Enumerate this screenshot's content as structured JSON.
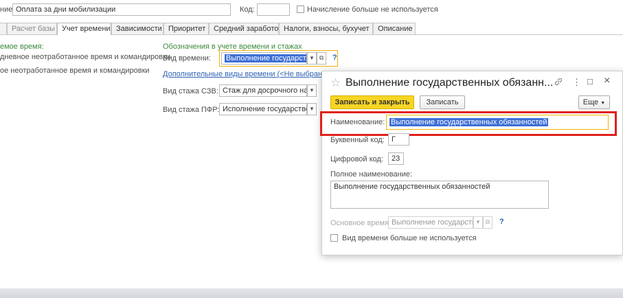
{
  "header": {
    "name_label_fragment": "ние:",
    "name_value": "Оплата за дни мобилизации",
    "code_label": "Код:",
    "code_value": "",
    "disabled_checkbox_label": "Начисление больше не используется"
  },
  "tabs": [
    {
      "label": "Расчет базы",
      "active": false,
      "dim": true
    },
    {
      "label": "Учет времени",
      "active": true,
      "dim": false
    },
    {
      "label": "Зависимости",
      "active": false,
      "dim": false
    },
    {
      "label": "Приоритет",
      "active": false,
      "dim": false
    },
    {
      "label": "Средний заработок",
      "active": false,
      "dim": false
    },
    {
      "label": "Налоги, взносы, бухучет",
      "active": false,
      "dim": false
    },
    {
      "label": "Описание",
      "active": false,
      "dim": false
    }
  ],
  "left_panel": {
    "heading": "емое время:",
    "line1": "дневное неотработанное время и командировки",
    "line2": "ое неотработанное время и командировки"
  },
  "time_section": {
    "heading": "Обозначения в учете времени и стажах",
    "time_kind_label": "Вид времени:",
    "time_kind_value": "Выполнение государстве",
    "help_mark": "?",
    "additional_link": "Дополнительные виды времени (<Не выбраны>)",
    "szv_label": "Вид стажа СЗВ:",
    "szv_value": "Стаж для досрочного наз",
    "pfr_label": "Вид стажа ПФР:",
    "pfr_value": "Исполнение государстве"
  },
  "dialog": {
    "star": "☆",
    "title": "Выполнение государственных обязанн...",
    "link_icon": "🔗",
    "more_icon": "⋮",
    "maximize_icon": "□",
    "close_icon": "×",
    "save_close_label": "Записать и закрыть",
    "save_label": "Записать",
    "more_label": "Еще",
    "name_label": "Наименование:",
    "name_value": "Выполнение государственных обязанностей",
    "letter_code_label": "Буквенный код:",
    "letter_code_value": "Г",
    "digit_code_label": "Цифровой код:",
    "digit_code_value": "23",
    "full_name_label": "Полное наименование:",
    "full_name_value": "Выполнение государственных обязанностей",
    "main_time_label": "Основное время:",
    "main_time_value": "Выполнение государстве",
    "help_mark": "?",
    "unused_checkbox_label": "Вид времени больше не используется"
  },
  "colors": {
    "accent_yellow": "#f7d523",
    "highlight_red": "#e0201b",
    "selection_blue": "#3d6fd6",
    "green_heading": "#3d8a3d"
  }
}
